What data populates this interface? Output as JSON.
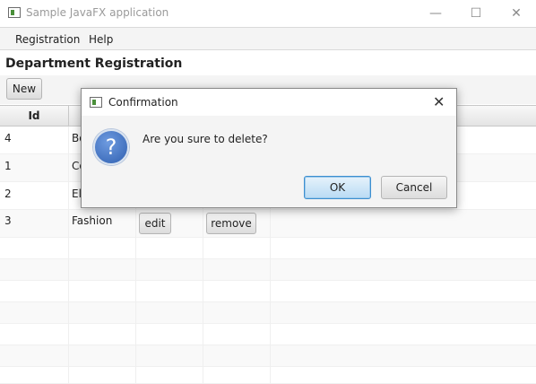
{
  "window": {
    "title": "Sample JavaFX application",
    "minimize": "—",
    "maximize": "☐",
    "close": "✕"
  },
  "menu": [
    {
      "label": "Registration"
    },
    {
      "label": "Help"
    }
  ],
  "heading": "Department Registration",
  "toolbar": {
    "new_label": "New"
  },
  "table": {
    "columns": [
      "Id",
      "",
      "",
      "",
      ""
    ],
    "rows": [
      {
        "id": "4",
        "name": "Bo",
        "edit": "",
        "remove": ""
      },
      {
        "id": "1",
        "name": "Co",
        "edit": "",
        "remove": ""
      },
      {
        "id": "2",
        "name": "El",
        "edit": "",
        "remove": ""
      },
      {
        "id": "3",
        "name": "Fashion",
        "edit": "edit",
        "remove": "remove"
      }
    ]
  },
  "dialog": {
    "title": "Confirmation",
    "close": "✕",
    "icon_glyph": "?",
    "message": "Are you sure to delete?",
    "ok_label": "OK",
    "cancel_label": "Cancel"
  }
}
